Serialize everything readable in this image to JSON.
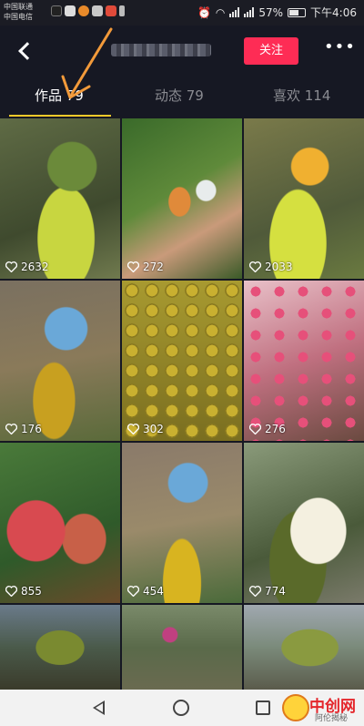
{
  "status_bar": {
    "carrier_1": "中国联通",
    "carrier_2": "中国电信",
    "battery": "57%",
    "time": "下午4:06"
  },
  "header": {
    "back_icon": "chevron-left-icon",
    "follow_label": "关注",
    "more_label": "•••"
  },
  "tabs": [
    {
      "label": "作品 79",
      "active": true
    },
    {
      "label": "动态 79",
      "active": false
    },
    {
      "label": "喜欢 114",
      "active": false
    }
  ],
  "colors": {
    "background": "#161823",
    "follow_button": "#fe2c55",
    "tab_indicator": "#fcca2a",
    "annotation_arrow": "#f29a3a"
  },
  "videos": [
    {
      "likes": "2632",
      "subject": "mangoes in baskets"
    },
    {
      "likes": "272",
      "subject": "cutting a mango"
    },
    {
      "likes": "2033",
      "subject": "sliced mango"
    },
    {
      "likes": "176",
      "subject": "harvesting mangoes"
    },
    {
      "likes": "302",
      "subject": "durians on ground"
    },
    {
      "likes": "276",
      "subject": "red apples on tree"
    },
    {
      "likes": "855",
      "subject": "red mangoes on tree"
    },
    {
      "likes": "454",
      "subject": "harvesting mangoes"
    },
    {
      "likes": "774",
      "subject": "opened durian"
    },
    {
      "likes": "",
      "subject": "jackfruit"
    },
    {
      "likes": "",
      "subject": "harvest with baskets"
    },
    {
      "likes": "",
      "subject": "jackfruit"
    }
  ],
  "watermark": {
    "title": "中创网",
    "subtitle": "阿伦揭秘"
  }
}
